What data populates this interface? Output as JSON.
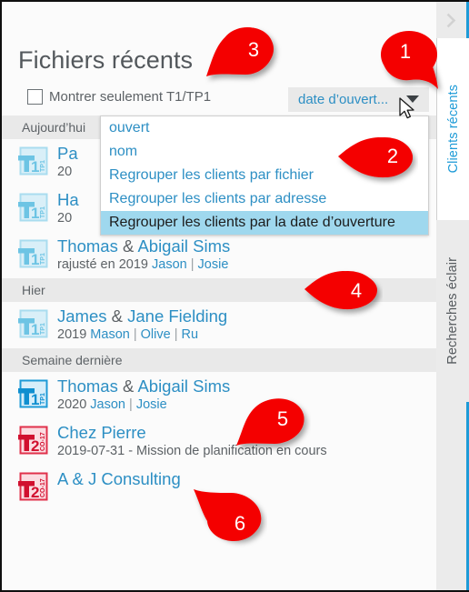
{
  "window": {
    "collapse_icon": "chevron-right-icon"
  },
  "tabs": [
    {
      "label": "Clients récents",
      "active": true
    },
    {
      "label": "Recherches éclair",
      "active": false
    }
  ],
  "header": {
    "title": "Fichiers récents",
    "checkbox_label": "Montrer seulement T1/TP1",
    "checkbox_checked": false
  },
  "sort_button": {
    "label": "date d’ouvert...",
    "caret_icon": "chevron-down-icon"
  },
  "dropdown": {
    "open": true,
    "items": [
      {
        "label": "ouvert",
        "selected": false
      },
      {
        "label": "nom",
        "selected": false
      },
      {
        "label": "Regrouper les clients par fichier",
        "selected": false
      },
      {
        "label": "Regrouper les clients par adresse",
        "selected": false
      },
      {
        "label": "Regrouper les clients par la date d’ouverture",
        "selected": true
      }
    ]
  },
  "groups": [
    {
      "heading": "Aujourd’hui",
      "rows": [
        {
          "icon": "t1-tp1-file-icon",
          "icon_variant": "pale-blue",
          "title_left": "Pa",
          "title_amp": "",
          "title_right": "",
          "sub_prefix": "20",
          "links": [],
          "truncated": true
        },
        {
          "icon": "t1-tp1-file-icon",
          "icon_variant": "pale-blue",
          "title_left": "Ha",
          "title_amp": "",
          "title_right": "",
          "sub_prefix": "20",
          "links": [],
          "truncated": true
        },
        {
          "icon": "t1-tp1-file-icon",
          "icon_variant": "pale-blue",
          "title_left": "Thomas",
          "title_amp": "&",
          "title_right": "Abigail Sims",
          "sub_prefix": "rajusté en 2019",
          "links": [
            "Jason",
            "Josie"
          ],
          "truncated": false
        }
      ]
    },
    {
      "heading": "Hier",
      "rows": [
        {
          "icon": "t1-tp1-file-icon",
          "icon_variant": "pale-blue",
          "title_left": "James",
          "title_amp": "&",
          "title_right": "Jane Fielding",
          "sub_prefix": "2019",
          "links": [
            "Mason",
            "Olive",
            "Ru"
          ],
          "truncated": false
        }
      ]
    },
    {
      "heading": "Semaine dernière",
      "rows": [
        {
          "icon": "t1-tp1-file-icon",
          "icon_variant": "bright-blue",
          "title_left": "Thomas",
          "title_amp": "&",
          "title_right": "Abigail Sims",
          "sub_prefix": "2020",
          "links": [
            "Jason",
            "Josie"
          ],
          "truncated": false
        },
        {
          "icon": "t2-co17-file-icon",
          "icon_variant": "red",
          "title_left": "Chez Pierre",
          "title_amp": "",
          "title_right": "",
          "sub_prefix": "2019-07-31 - Mission de planification en cours",
          "links": [],
          "truncated": false
        },
        {
          "icon": "t2-co17-file-icon",
          "icon_variant": "red",
          "title_left": "A & J Consulting",
          "title_amp": "",
          "title_right": "",
          "sub_prefix": "",
          "links": [],
          "truncated": false
        }
      ]
    }
  ],
  "callouts": [
    {
      "number": "1"
    },
    {
      "number": "2"
    },
    {
      "number": "3"
    },
    {
      "number": "4"
    },
    {
      "number": "5"
    },
    {
      "number": "6"
    }
  ],
  "colors": {
    "accent_blue": "#2d8fc4",
    "tab_blue": "#1e9bd7",
    "text_gray": "#5d6266",
    "callout_red": "#f40000",
    "highlight_blue": "#9fd8ee",
    "icon_red": "#e0314b",
    "icon_pale_blue": "#6dc4e4"
  }
}
